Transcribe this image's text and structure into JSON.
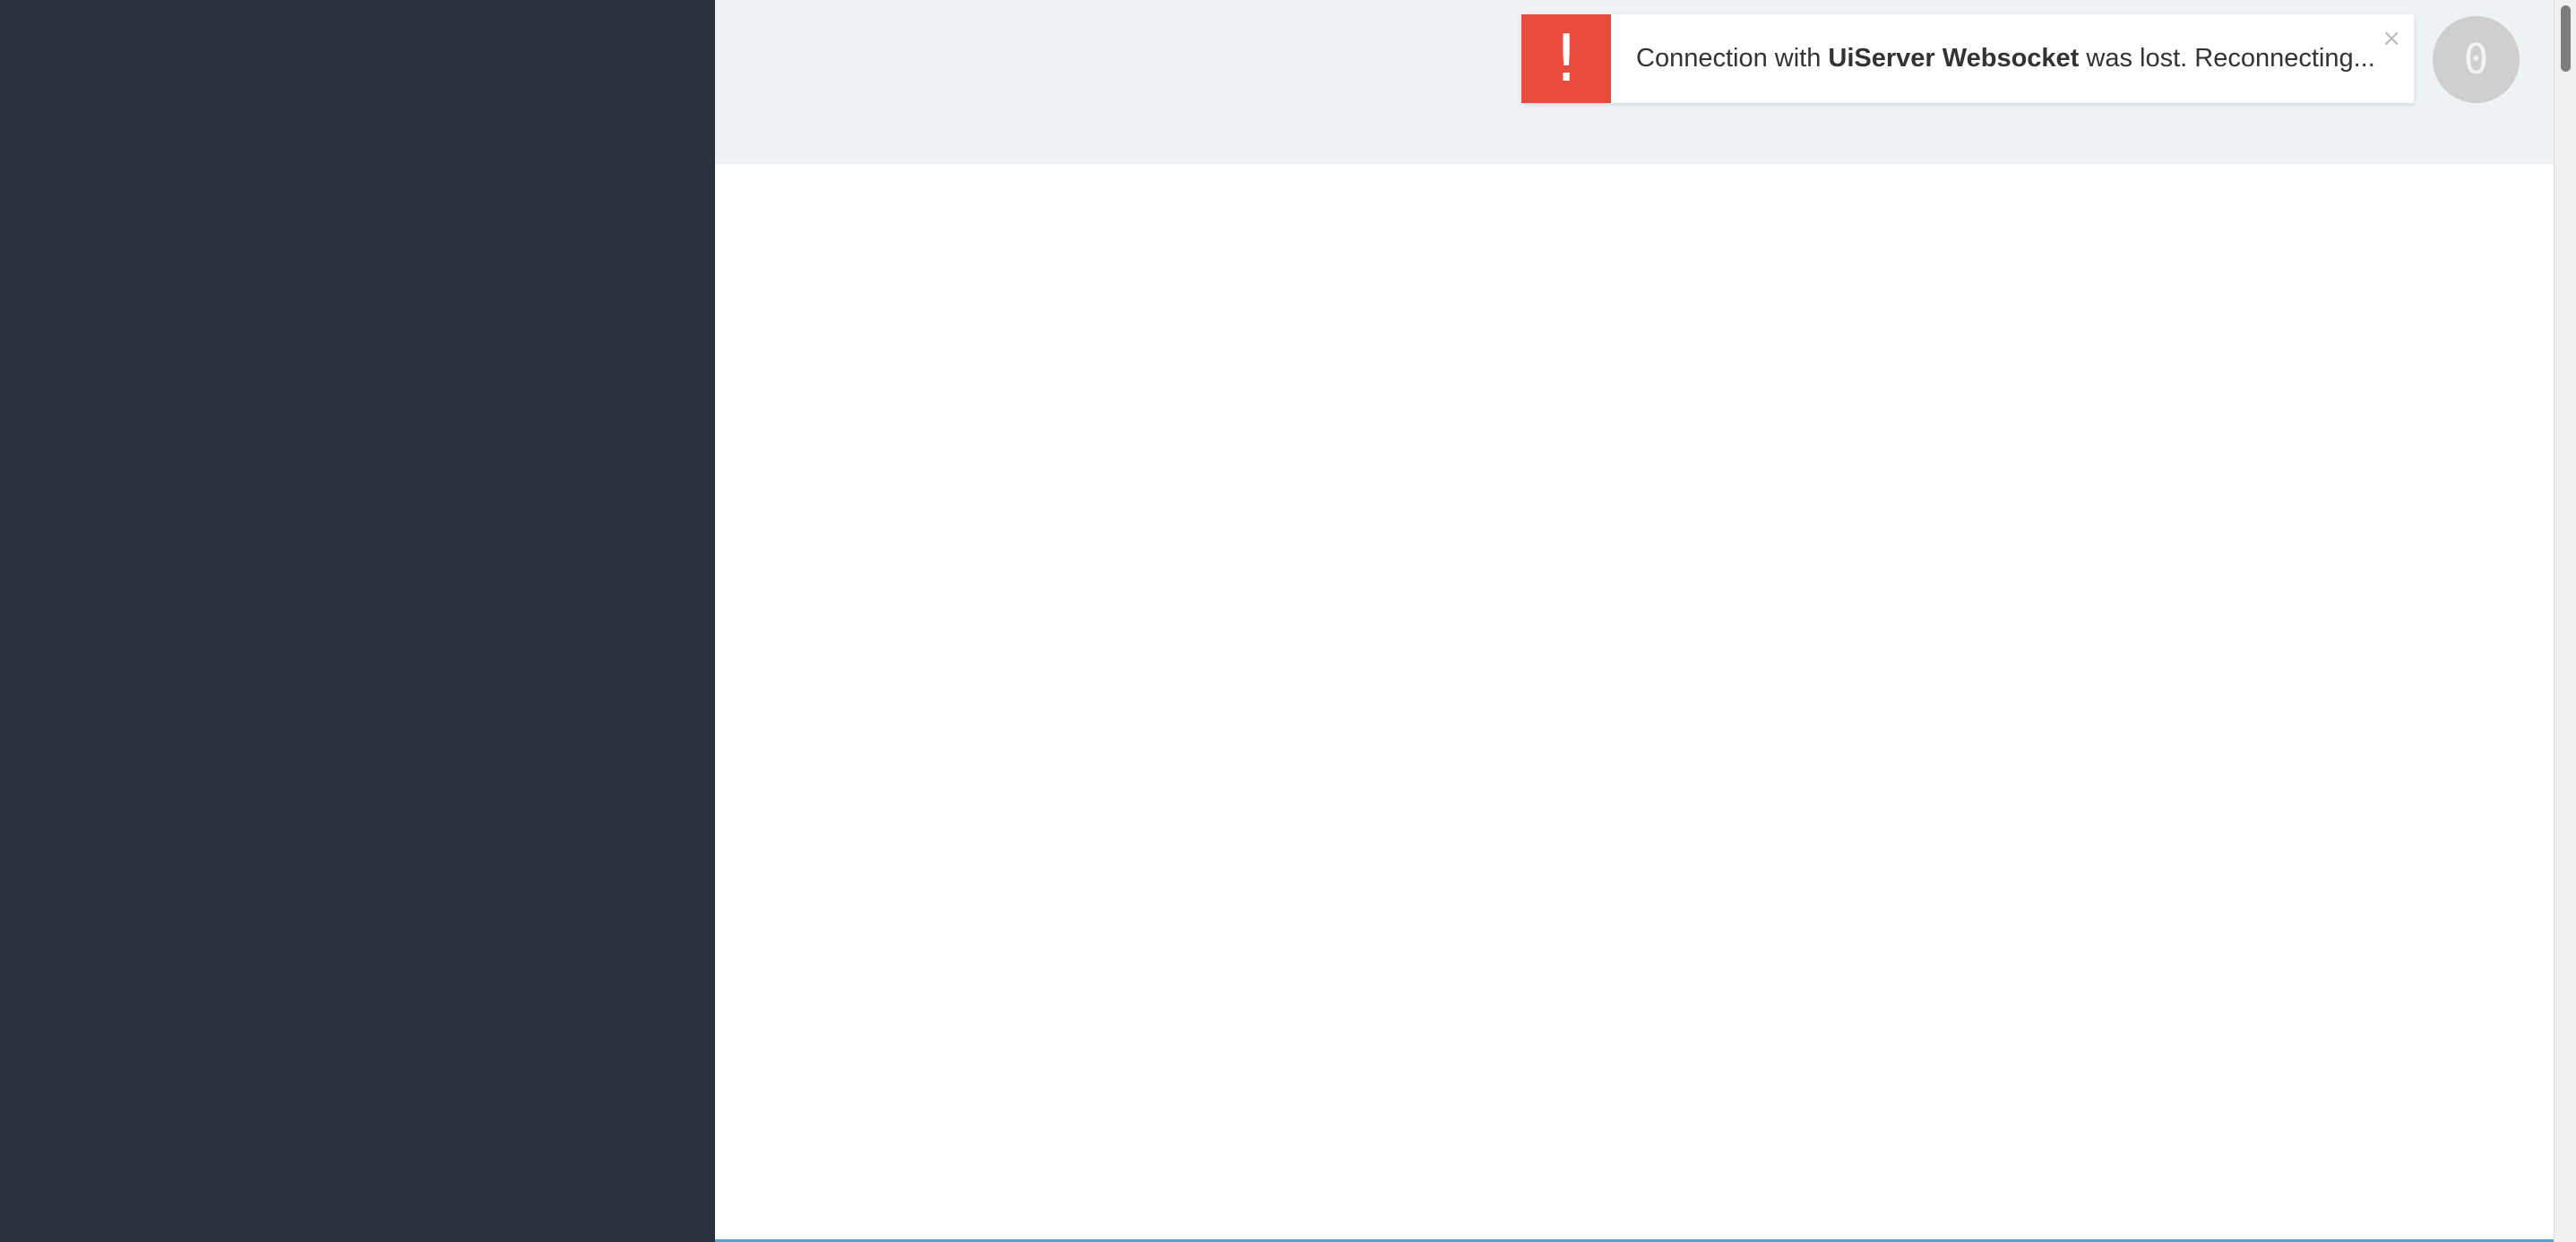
{
  "notification": {
    "icon": "exclamation-icon",
    "icon_glyph": "!",
    "text_before": "Connection with",
    "text_bold": "UiServer Websocket",
    "text_after": "was lost. Reconnecting...",
    "close_glyph": "×",
    "accent_color": "#e94c3d"
  },
  "badge": {
    "count": "0"
  },
  "colors": {
    "sidebar": "#2b323d",
    "topbar": "#edf2f4",
    "content": "#ffffff"
  }
}
